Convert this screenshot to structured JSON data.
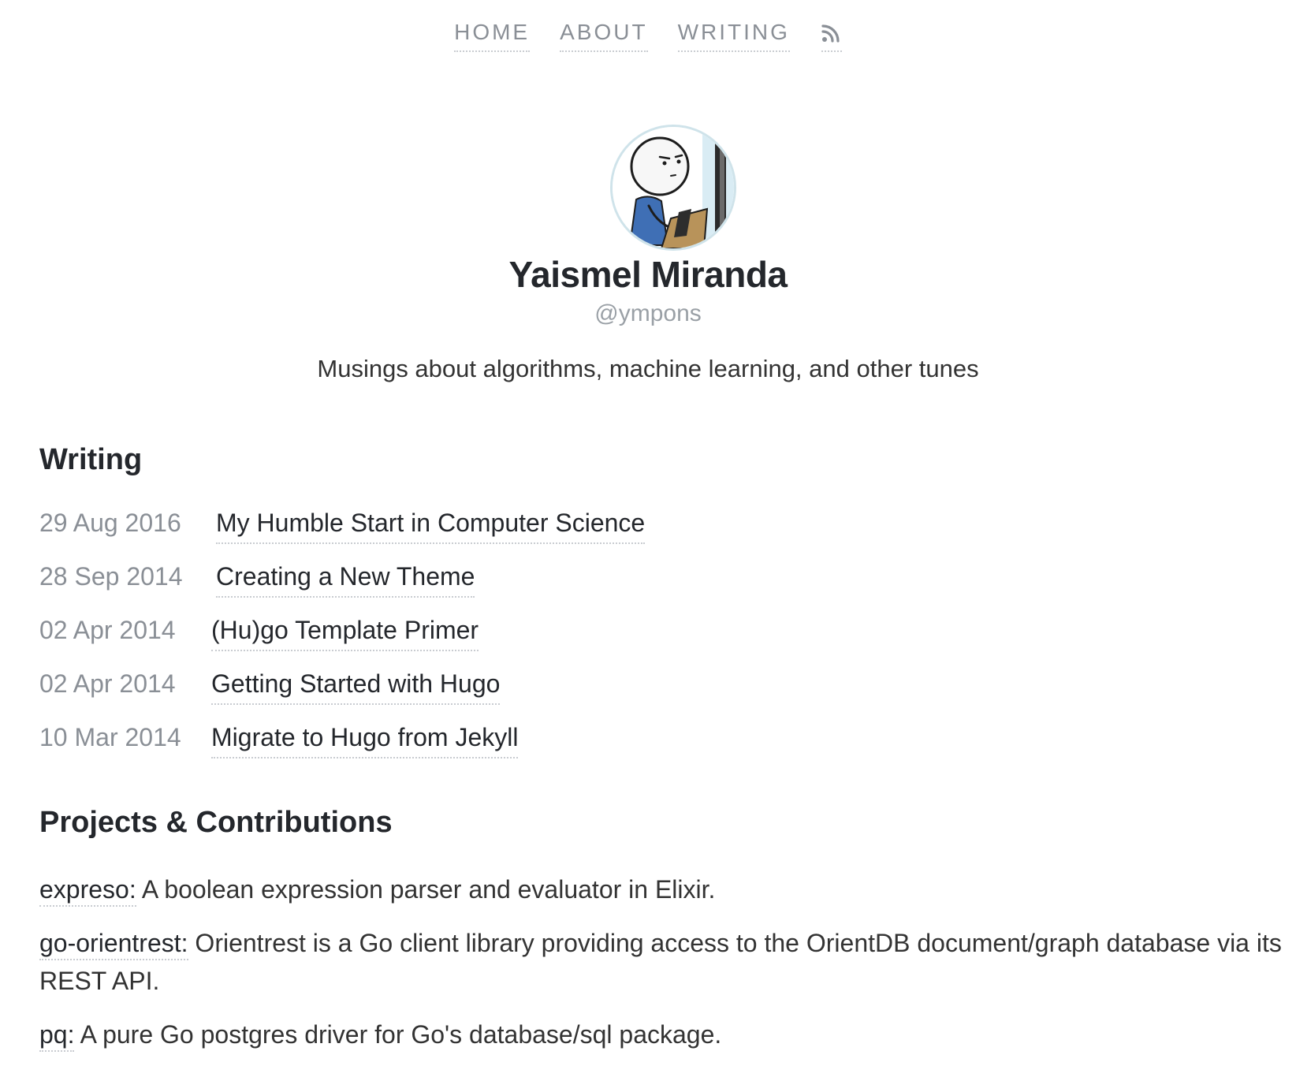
{
  "nav": {
    "items": [
      {
        "label": "HOME"
      },
      {
        "label": "ABOUT"
      },
      {
        "label": "WRITING"
      }
    ],
    "rss_icon": "rss-icon"
  },
  "profile": {
    "avatar_icon": "stick-figure-avatar",
    "name": "Yaismel Miranda",
    "handle": "@ympons",
    "tagline": "Musings about algorithms, machine learning, and other tunes"
  },
  "writing": {
    "title": "Writing",
    "posts": [
      {
        "date": "29 Aug 2016",
        "title": "My Humble Start in Computer Science"
      },
      {
        "date": "28 Sep 2014",
        "title": "Creating a New Theme"
      },
      {
        "date": "02 Apr 2014",
        "title": "(Hu)go Template Primer"
      },
      {
        "date": "02 Apr 2014",
        "title": "Getting Started with Hugo"
      },
      {
        "date": "10 Mar 2014",
        "title": "Migrate to Hugo from Jekyll"
      }
    ]
  },
  "projects": {
    "title": "Projects & Contributions",
    "items": [
      {
        "name": "expreso:",
        "description": "A boolean expression parser and evaluator in Elixir."
      },
      {
        "name": "go-orientrest:",
        "description": "Orientrest is a Go client library providing access to the OrientDB document/graph database via its REST API."
      },
      {
        "name": "pq:",
        "description": "A pure Go postgres driver for Go's database/sql package."
      }
    ]
  },
  "colors": {
    "text": "#24272c",
    "muted": "#8a8f96",
    "link_underline": "#c9ccd1",
    "background": "#ffffff"
  }
}
